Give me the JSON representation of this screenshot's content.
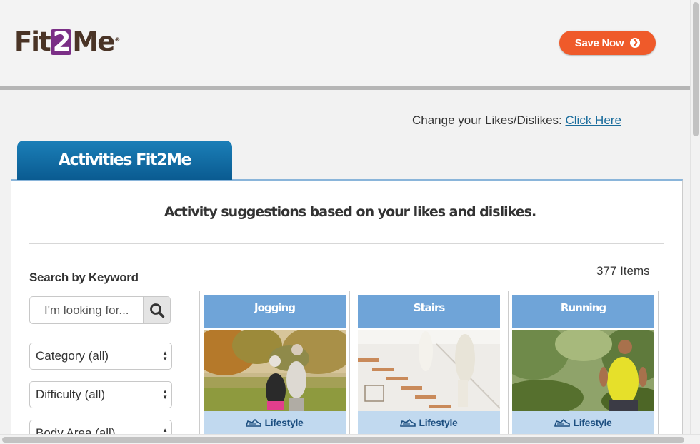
{
  "header": {
    "logo": {
      "part1": "Fit",
      "part2": "2",
      "part3": "Me",
      "trademark": "®"
    },
    "save_button": "Save Now",
    "save_icon": "chevron-circle-right-icon",
    "colors": {
      "brand": "#4a3426",
      "brand_accent": "#7b2f86",
      "cta": "#ef5a2a"
    }
  },
  "preferences": {
    "prompt": "Change your Likes/Dislikes:",
    "link": "Click Here"
  },
  "tab": {
    "label": "Activities Fit2Me"
  },
  "subtitle": "Activity suggestions based on your likes and dislikes.",
  "sidebar": {
    "search_label": "Search by Keyword",
    "search_placeholder": "I'm looking for...",
    "search_icon": "magnifier-icon",
    "filters": [
      "Category (all)",
      "Difficulty (all)",
      "Body Area (all)"
    ]
  },
  "results": {
    "count": "377 Items",
    "cards": [
      {
        "title": "Jogging",
        "tag": "Lifestyle",
        "tag_icon": "shoe-icon"
      },
      {
        "title": "Stairs",
        "tag": "Lifestyle",
        "tag_icon": "shoe-icon"
      },
      {
        "title": "Running",
        "tag": "Lifestyle",
        "tag_icon": "shoe-icon"
      }
    ]
  },
  "colors": {
    "tab_blue": "#0a5b91",
    "card_title_blue": "#6fa4d8",
    "tag_blue": "#c1d9ef",
    "link_blue": "#1a6c9c"
  }
}
